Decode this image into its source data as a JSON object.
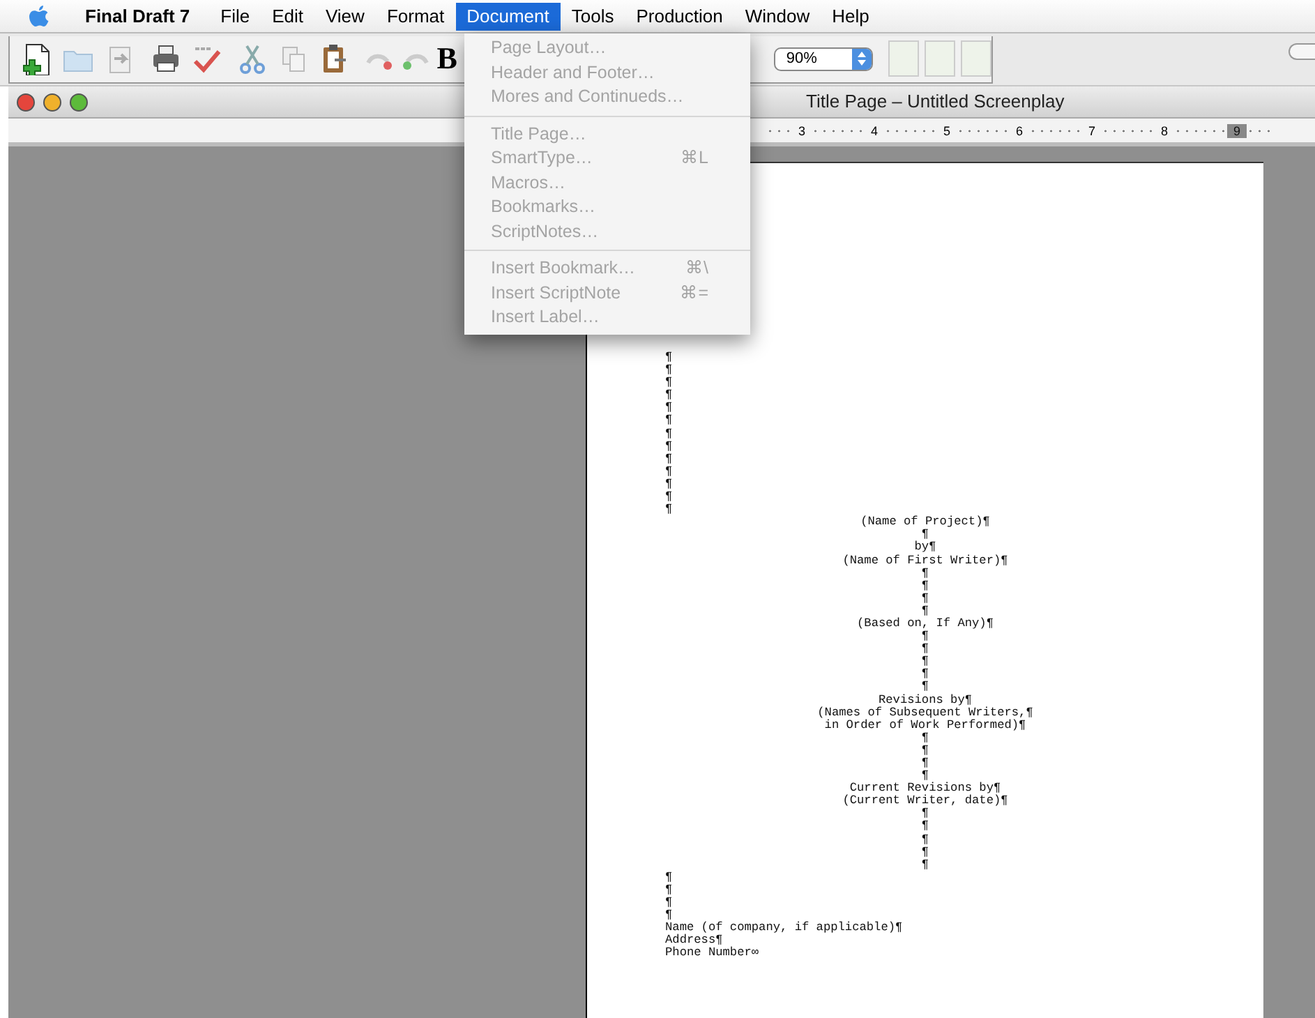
{
  "menu_bar": {
    "app_name": "Final Draft 7",
    "items": [
      {
        "label": "File",
        "selected": false
      },
      {
        "label": "Edit",
        "selected": false
      },
      {
        "label": "View",
        "selected": false
      },
      {
        "label": "Format",
        "selected": false
      },
      {
        "label": "Document",
        "selected": true
      },
      {
        "label": "Tools",
        "selected": false
      },
      {
        "label": "Production",
        "selected": false
      },
      {
        "label": "Window",
        "selected": false
      },
      {
        "label": "Help",
        "selected": false
      }
    ]
  },
  "toolbar": {
    "bold_label": "B",
    "zoom": {
      "value": "90%"
    }
  },
  "document_menu": {
    "items": [
      {
        "kind": "item",
        "label": "Page Layout…",
        "disabled": true
      },
      {
        "kind": "item",
        "label": "Header and Footer…",
        "disabled": true
      },
      {
        "kind": "item",
        "label": "Mores and Continueds…",
        "disabled": true
      },
      {
        "kind": "separator"
      },
      {
        "kind": "item",
        "label": "Title Page…",
        "disabled": true
      },
      {
        "kind": "item",
        "label": "SmartType…",
        "shortcut": "⌘L",
        "disabled": true
      },
      {
        "kind": "item",
        "label": "Macros…",
        "disabled": true
      },
      {
        "kind": "item",
        "label": "Bookmarks…",
        "disabled": true
      },
      {
        "kind": "item",
        "label": "ScriptNotes…",
        "disabled": true
      },
      {
        "kind": "separator"
      },
      {
        "kind": "item",
        "label": "Insert Bookmark…",
        "shortcut": "⌘\\",
        "disabled": true
      },
      {
        "kind": "item",
        "label": "Insert ScriptNote",
        "shortcut": "⌘=",
        "disabled": true
      },
      {
        "kind": "item",
        "label": "Insert Label…",
        "disabled": true
      }
    ]
  },
  "window": {
    "title": "Title Page – Untitled Screenplay",
    "ruler": [
      {
        "label": "3",
        "selected": false
      },
      {
        "label": "4",
        "selected": false
      },
      {
        "label": "5",
        "selected": false
      },
      {
        "label": "6",
        "selected": false
      },
      {
        "label": "7",
        "selected": false
      },
      {
        "label": "8",
        "selected": false
      },
      {
        "label": "9",
        "selected": true
      }
    ]
  },
  "page": {
    "top_marks": [
      "¶",
      "¶",
      "¶",
      "¶",
      "¶",
      "¶",
      "¶",
      "¶",
      "¶",
      "¶",
      "¶",
      "¶",
      "¶"
    ],
    "centered_lines": [
      "(Name of Project)¶",
      "¶",
      "by¶",
      "(Name of First Writer)¶",
      "¶",
      "¶",
      "¶",
      "¶",
      "(Based on, If Any)¶",
      "¶",
      "¶",
      "¶",
      "¶",
      "¶",
      "Revisions by¶",
      "(Names of Subsequent Writers,¶",
      "in Order of Work Performed)¶",
      "¶",
      "¶",
      "¶",
      "¶",
      "Current Revisions by¶",
      "(Current Writer, date)¶",
      "¶",
      "¶",
      "¶",
      "¶",
      "¶"
    ],
    "bottom_lines": [
      "¶",
      "¶",
      "¶",
      "¶",
      "Name (of company, if applicable)¶",
      "Address¶",
      "Phone Number∞"
    ]
  }
}
